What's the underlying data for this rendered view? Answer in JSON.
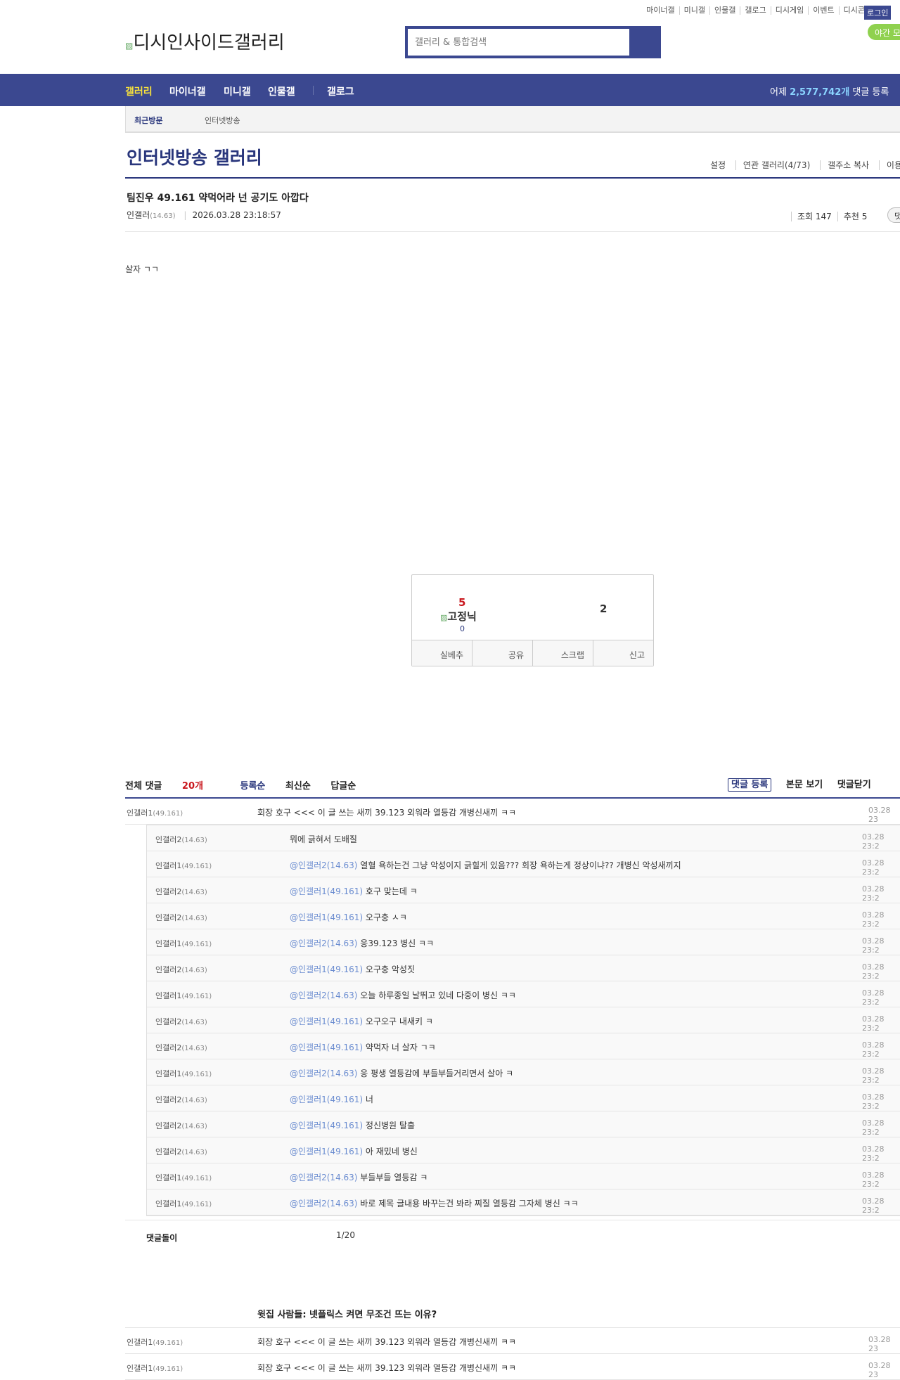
{
  "top_links": [
    "마이너갤",
    "미니갤",
    "인물갤",
    "갤로그",
    "디시게임",
    "이벤트",
    "디시콘"
  ],
  "login": "로그인",
  "night_mode": "야간 모",
  "logo_alt": "디시인사이드갤러리",
  "search": {
    "placeholder": "갤러리 & 통합검색"
  },
  "nav": {
    "items": [
      "갤러리",
      "마이너갤",
      "미니갤",
      "인물갤",
      "갤로그"
    ],
    "stat_prefix": "어제 ",
    "stat_count": "2,577,742개",
    "stat_suffix": " 댓글 등록",
    "active_color": "#f9e33b"
  },
  "subbar": {
    "recent": "최근방문",
    "item": "인터넷방송"
  },
  "gallery": {
    "title": "인터넷방송 갤러리",
    "links": [
      "설정",
      "연관 갤러리(4/73)",
      "갤주소 복사",
      "이용"
    ]
  },
  "post": {
    "title": "팀진우 49.161 약먹어라 넌 공기도 아깝다",
    "author": "인갤러",
    "ip": "(14.63)",
    "date": "2026.03.28 23:18:57",
    "views": "조회 147",
    "recommend": "추천 5",
    "comment_btn": "댓",
    "body": "살자 ㄱㄱ"
  },
  "recommend_box": {
    "up": "5",
    "fixed_alt": "고정닉",
    "fixed_count": "0",
    "down": "2",
    "buttons": [
      "실베추",
      "공유",
      "스크랩",
      "신고"
    ]
  },
  "comments": {
    "total_label": "전체 댓글 ",
    "total_count": "20개",
    "sorts": [
      "등록순",
      "최신순",
      "답글순"
    ],
    "actions": [
      "댓글 등록",
      "본문 보기",
      "댓글닫기"
    ],
    "top": {
      "name": "인갤러1",
      "ip": "(49.161)",
      "text": "회장 호구 <<< 이 글 쓰는 새끼 39.123 외워라 열등감 개병신새끼 ㅋㅋ",
      "date": "03.28 23"
    },
    "replies": [
      {
        "name": "인갤러2",
        "ip": "(14.63)",
        "mention": "",
        "text": "뭐에 긁혀서 도배질",
        "date": "03.28 23:2"
      },
      {
        "name": "인갤러1",
        "ip": "(49.161)",
        "mention": "@인갤러2(14.63)",
        "text": " 열혈 욕하는건 그냥 악성이지 긁힐게 있음??? 회장 욕하는게 정상이냐?? 개병신 악성새끼지",
        "date": "03.28 23:2"
      },
      {
        "name": "인갤러2",
        "ip": "(14.63)",
        "mention": "@인갤러1(49.161)",
        "text": " 호구 맞는데 ㅋ",
        "date": "03.28 23:2"
      },
      {
        "name": "인갤러2",
        "ip": "(14.63)",
        "mention": "@인갤러1(49.161)",
        "text": " 오구충 ㅅㅋ",
        "date": "03.28 23:2"
      },
      {
        "name": "인갤러1",
        "ip": "(49.161)",
        "mention": "@인갤러2(14.63)",
        "text": " 응39.123 병신 ㅋㅋ",
        "date": "03.28 23:2"
      },
      {
        "name": "인갤러2",
        "ip": "(14.63)",
        "mention": "@인갤러1(49.161)",
        "text": " 오구충 악성짓",
        "date": "03.28 23:2"
      },
      {
        "name": "인갤러1",
        "ip": "(49.161)",
        "mention": "@인갤러2(14.63)",
        "text": " 오늘 하루종일 날뛰고 있네 다중이 병신 ㅋㅋ",
        "date": "03.28 23:2"
      },
      {
        "name": "인갤러2",
        "ip": "(14.63)",
        "mention": "@인갤러1(49.161)",
        "text": " 오구오구 내새키 ㅋ",
        "date": "03.28 23:2"
      },
      {
        "name": "인갤러2",
        "ip": "(14.63)",
        "mention": "@인갤러1(49.161)",
        "text": " 약먹자 너 살자 ㄱㅋ",
        "date": "03.28 23:2"
      },
      {
        "name": "인갤러1",
        "ip": "(49.161)",
        "mention": "@인갤러2(14.63)",
        "text": " 응 평생 열등감에 부들부들거리면서 살아 ㅋ",
        "date": "03.28 23:2"
      },
      {
        "name": "인갤러2",
        "ip": "(14.63)",
        "mention": "@인갤러1(49.161)",
        "text": " 너",
        "date": "03.28 23:2"
      },
      {
        "name": "인갤러2",
        "ip": "(14.63)",
        "mention": "@인갤러1(49.161)",
        "text": " 정신병원 탈출",
        "date": "03.28 23:2"
      },
      {
        "name": "인갤러2",
        "ip": "(14.63)",
        "mention": "@인갤러1(49.161)",
        "text": " 아 재밌네 병신",
        "date": "03.28 23:2"
      },
      {
        "name": "인갤러1",
        "ip": "(49.161)",
        "mention": "@인갤러2(14.63)",
        "text": " 부들부들 열등감 ㅋ",
        "date": "03.28 23:2"
      },
      {
        "name": "인갤러1",
        "ip": "(49.161)",
        "mention": "@인갤러2(14.63)",
        "text": " 바로 제목 글내용 바꾸는건 봐라 찌질 열등감 그자체 병신 ㅋㅋ",
        "date": "03.28 23:2"
      }
    ],
    "bot_label": "댓글돌이",
    "bot_page": "1/20"
  },
  "below": {
    "title": "윗집 사람들: 넷플릭스 켜면 무조건 뜨는 이유?",
    "rows": [
      {
        "name": "인갤러1",
        "ip": "(49.161)",
        "text": "회장 호구 <<< 이 글 쓰는 새끼 39.123 외워라 열등감 개병신새끼 ㅋㅋ",
        "date": "03.28 23"
      },
      {
        "name": "인갤러1",
        "ip": "(49.161)",
        "text": "회장 호구 <<< 이 글 쓰는 새끼 39.123 외워라 열등감 개병신새끼 ㅋㅋ",
        "date": "03.28 23"
      }
    ]
  }
}
